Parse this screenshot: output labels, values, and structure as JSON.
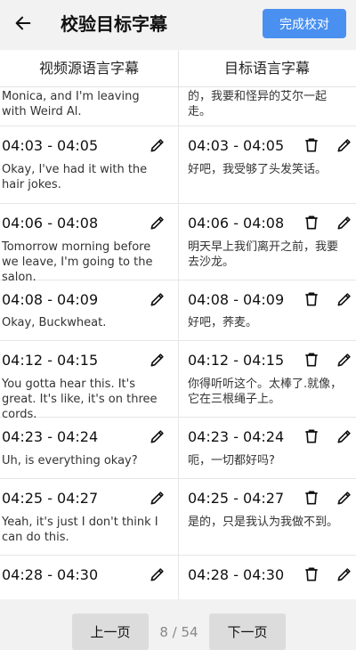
{
  "header": {
    "title": "校验目标字幕",
    "finish_label": "完成校对"
  },
  "columns": {
    "source": "视频源语言字幕",
    "target": "目标语言字幕"
  },
  "rows": [
    {
      "source_time": "",
      "source_text": "Monica, and I'm leaving with Weird Al.",
      "target_time": "",
      "target_text": "的，我要和怪异的艾尔一起走。"
    },
    {
      "source_time": "04:03 - 04:05",
      "source_text": "Okay, I've had it with the hair jokes.",
      "target_time": "04:03 - 04:05",
      "target_text": "好吧，我受够了头发笑话。"
    },
    {
      "source_time": "04:06 - 04:08",
      "source_text": "Tomorrow morning before we leave, I'm going to the salon.",
      "target_time": "04:06 - 04:08",
      "target_text": "明天早上我们离开之前，我要去沙龙。"
    },
    {
      "source_time": "04:08 - 04:09",
      "source_text": "Okay, Buckwheat.",
      "target_time": "04:08 - 04:09",
      "target_text": "好吧，荞麦。"
    },
    {
      "source_time": "04:12 - 04:15",
      "source_text": "You gotta hear this. It's great. It's like, it's on three cords.",
      "target_time": "04:12 - 04:15",
      "target_text": "你得听听这个。太棒了.就像，它在三根绳子上。"
    },
    {
      "source_time": "04:23 - 04:24",
      "source_text": "Uh, is everything okay?",
      "target_time": "04:23 - 04:24",
      "target_text": "呃，一切都好吗?"
    },
    {
      "source_time": "04:25 - 04:27",
      "source_text": "Yeah, it's just I don't think I can do this.",
      "target_time": "04:25 - 04:27",
      "target_text": "是的，只是我认为我做不到。"
    },
    {
      "source_time": "04:28 - 04:30",
      "source_text": "",
      "target_time": "04:28 - 04:30",
      "target_text": ""
    }
  ],
  "pagination": {
    "prev_label": "上一页",
    "next_label": "下一页",
    "page_info": "8 / 54"
  }
}
